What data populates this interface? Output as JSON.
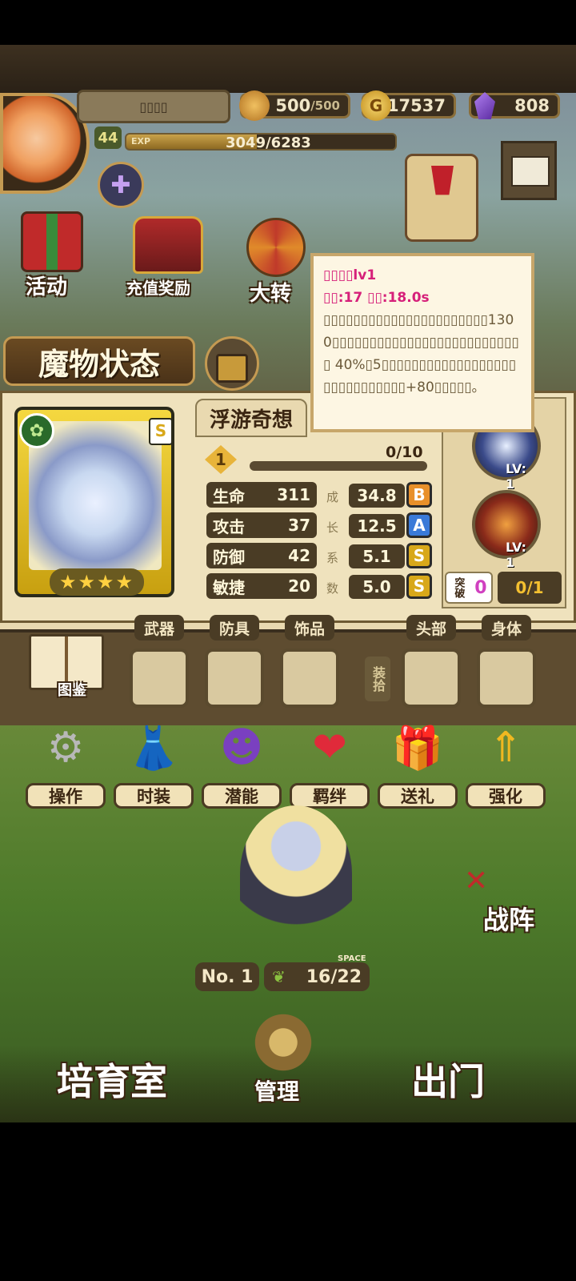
{
  "player": {
    "name": "▯▯▯▯",
    "level": "44",
    "exp_label": "EXP",
    "exp_text": "3049/6283",
    "exp_progress": 0.485
  },
  "currencies": {
    "stamina": {
      "value": "500",
      "max": "/500"
    },
    "gold": {
      "icon": "G",
      "value": "17537"
    },
    "gems": {
      "value": "808"
    }
  },
  "town_menu": {
    "activity": "活动",
    "recharge_reward": "充值奖励",
    "big_wheel": "大转",
    "mail_icon": "mail-icon"
  },
  "status_title": "魔物状态",
  "monster": {
    "name": "浮游奇想",
    "rank_badge": "S",
    "stars": 4,
    "star_glyphs": "★★★★",
    "level_badge": "1",
    "progress": "0/10",
    "progress_value": 0.0,
    "stats": [
      {
        "label": "生命",
        "value": "311",
        "growth": "34.8",
        "grade": "B",
        "grade_color": "#e8902a"
      },
      {
        "label": "攻击",
        "value": "37",
        "growth": "12.5",
        "grade": "A",
        "grade_color": "#3a7ad8"
      },
      {
        "label": "防御",
        "value": "42",
        "growth": "5.1",
        "grade": "S",
        "grade_color": "#d8a81a"
      },
      {
        "label": "敏捷",
        "value": "20",
        "growth": "5.0",
        "grade": "S",
        "grade_color": "#d8a81a"
      }
    ],
    "growth_chars": [
      "成",
      "长",
      "系",
      "数"
    ]
  },
  "skills": {
    "skill1_level": "LV: 1",
    "skill2_level": "LV: 1",
    "breakthrough_label": "突破",
    "breakthrough_count": "0",
    "breakthrough_progress": "0/1"
  },
  "tooltip": {
    "title": "▯▯▯▯lv1",
    "line2": "▯▯:17   ▯▯:18.0s",
    "body": "▯▯▯▯▯▯▯▯▯▯▯▯▯▯▯▯▯▯▯▯▯▯1300▯▯▯▯▯▯▯▯▯▯▯▯▯▯▯▯▯▯▯▯▯▯▯▯▯▯ 40%▯5▯▯▯▯▯▯▯▯▯▯▯▯▯▯▯▯▯▯▯▯▯▯▯▯▯▯▯▯▯+80▯▯▯▯▯。"
  },
  "equipment": {
    "weapon": "武器",
    "armor": "防具",
    "accessory": "饰品",
    "pick_up": "装拾",
    "head": "头部",
    "body": "身体",
    "codex": "图鉴"
  },
  "actions": [
    {
      "label": "操作",
      "icon": "gear-icon"
    },
    {
      "label": "时装",
      "icon": "outfit-icon"
    },
    {
      "label": "潜能",
      "icon": "demon-icon"
    },
    {
      "label": "羁绊",
      "icon": "hearts-icon"
    },
    {
      "label": "送礼",
      "icon": "gift-icon"
    },
    {
      "label": "强化",
      "icon": "upgrade-arrows-icon"
    }
  ],
  "formation": "战阵",
  "bottom": {
    "number_label": "No. 1",
    "space_label": "SPACE",
    "space_value": "16/22",
    "nursery": "培育室",
    "manage": "管理",
    "go_out": "出门"
  }
}
